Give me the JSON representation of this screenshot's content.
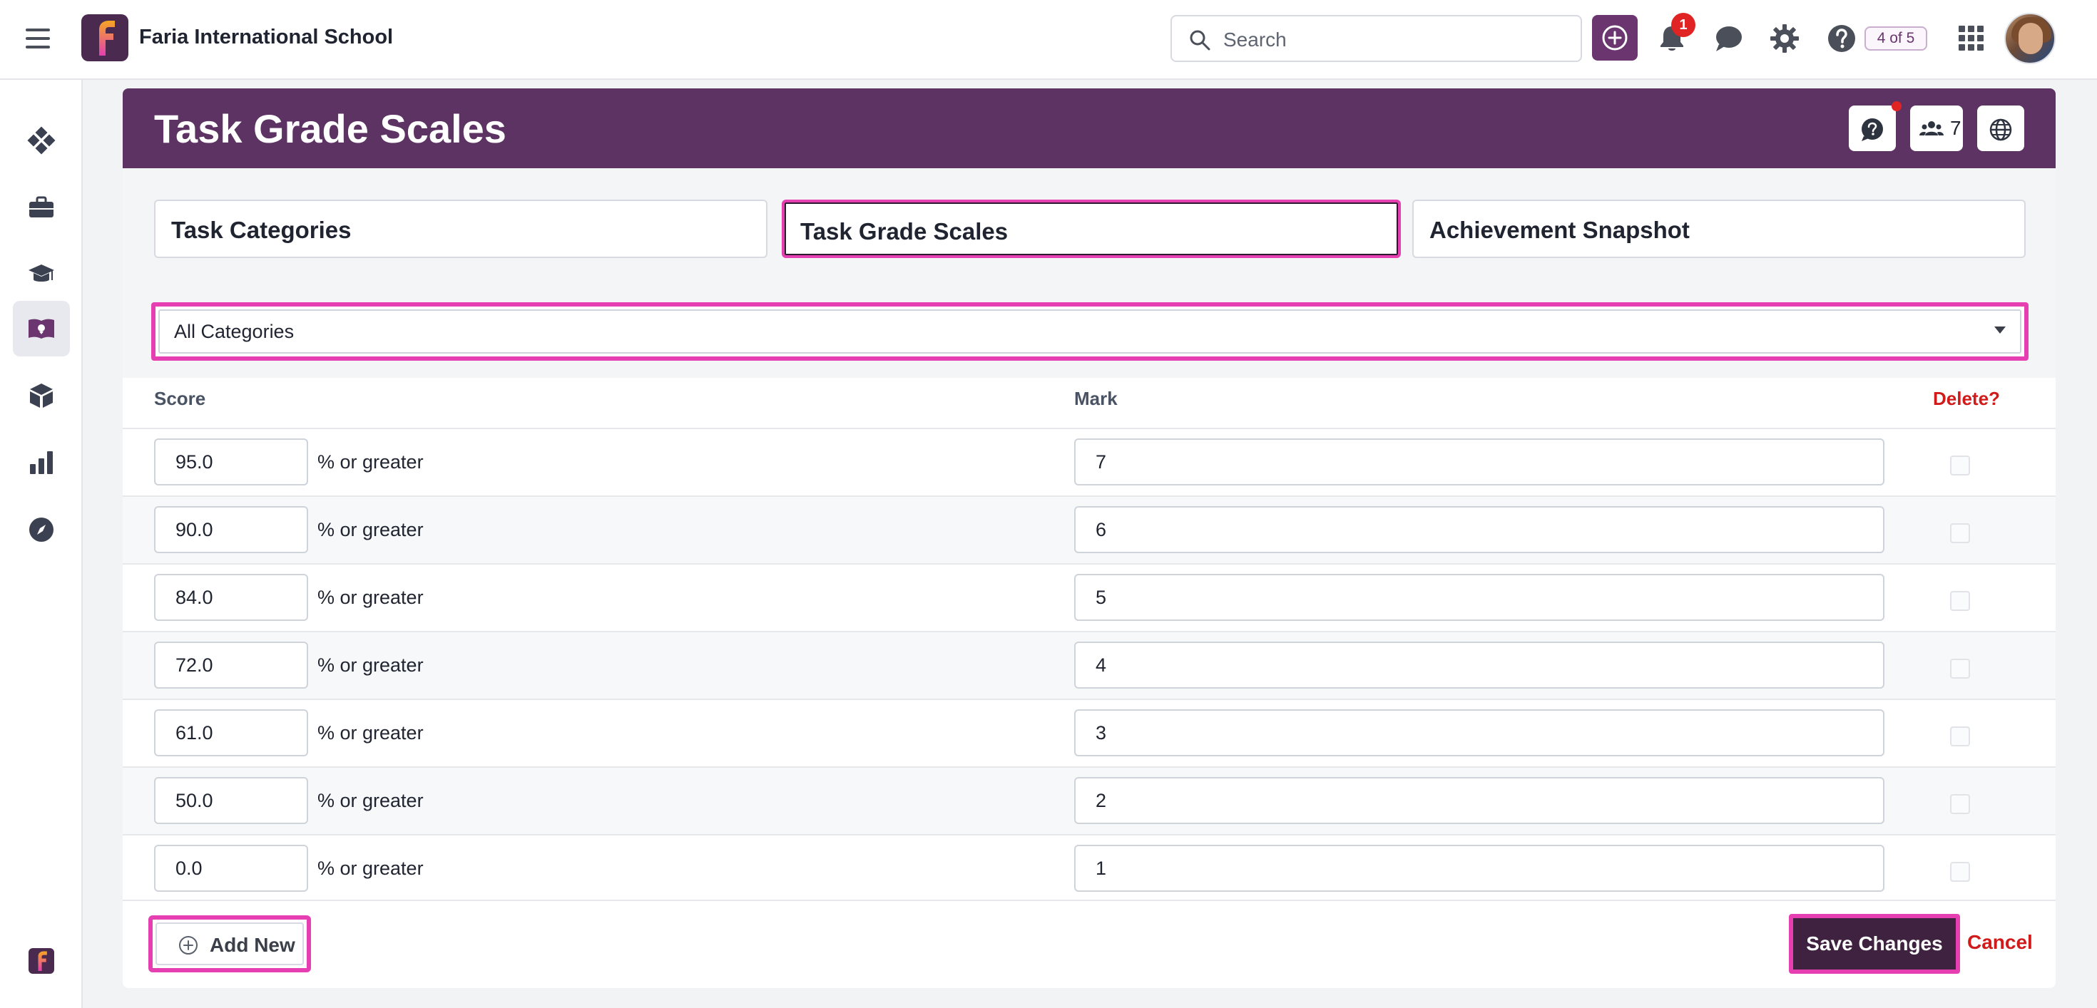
{
  "topbar": {
    "school_name": "Faria International School",
    "search_placeholder": "Search",
    "notification_count": "1",
    "counter": "4 of 5",
    "accent_color": "#6b3570"
  },
  "sidebar": {
    "items": [
      {
        "icon": "dashboard-icon",
        "active": false
      },
      {
        "icon": "briefcase-icon",
        "active": false
      },
      {
        "icon": "graduation-cap-icon",
        "active": false
      },
      {
        "icon": "book-icon",
        "active": true
      },
      {
        "icon": "cube-icon",
        "active": false
      },
      {
        "icon": "bar-chart-icon",
        "active": false
      },
      {
        "icon": "compass-icon",
        "active": false
      }
    ]
  },
  "page": {
    "title": "Task Grade Scales",
    "header_color": "#5c3362",
    "member_count": "7"
  },
  "tabs": [
    {
      "label": "Task Categories",
      "active": false
    },
    {
      "label": "Task Grade Scales",
      "active": true
    },
    {
      "label": "Achievement Snapshot",
      "active": false
    }
  ],
  "category_select": {
    "value": "All Categories"
  },
  "table": {
    "headers": {
      "score": "Score",
      "mark": "Mark",
      "delete": "Delete?"
    },
    "score_suffix": "% or greater",
    "rows": [
      {
        "score": "95.0",
        "mark": "7"
      },
      {
        "score": "90.0",
        "mark": "6"
      },
      {
        "score": "84.0",
        "mark": "5"
      },
      {
        "score": "72.0",
        "mark": "4"
      },
      {
        "score": "61.0",
        "mark": "3"
      },
      {
        "score": "50.0",
        "mark": "2"
      },
      {
        "score": "0.0",
        "mark": "1"
      }
    ]
  },
  "actions": {
    "add_new": "Add New",
    "save": "Save Changes",
    "cancel": "Cancel"
  },
  "highlight_color": "#e63fb1"
}
